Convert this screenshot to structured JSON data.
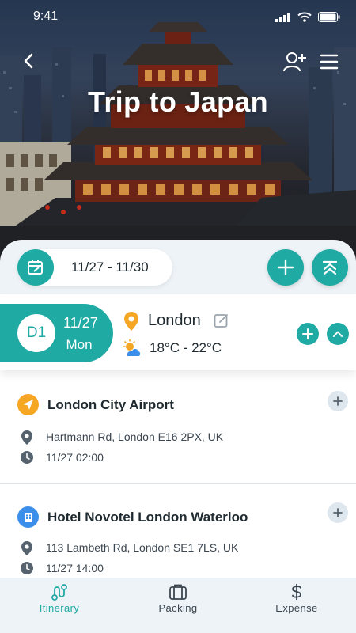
{
  "status_bar": {
    "time": "9:41"
  },
  "header": {
    "title": "Trip to Japan"
  },
  "date_bar": {
    "range": "11/27 - 11/30"
  },
  "day": {
    "code": "D1",
    "date": "11/27",
    "weekday": "Mon",
    "location": "London",
    "temperature": "18°C - 22°C"
  },
  "places": [
    {
      "name": "London City Airport",
      "type_icon": "plane-icon",
      "icon_color": "#f5a623",
      "address": "Hartmann Rd, London E16 2PX, UK",
      "time": "11/27 02:00"
    },
    {
      "name": "Hotel Novotel London Waterloo",
      "type_icon": "hotel-icon",
      "icon_color": "#3b8eea",
      "address": "113 Lambeth Rd, London SE1 7LS, UK",
      "time": "11/27 14:00"
    }
  ],
  "tabs": [
    {
      "label": "Itinerary",
      "icon": "route-icon",
      "active": true
    },
    {
      "label": "Packing",
      "icon": "suitcase-icon",
      "active": false
    },
    {
      "label": "Expense",
      "icon": "dollar-icon",
      "active": false
    }
  ],
  "colors": {
    "accent": "#1faaa4",
    "pin": "#f5a623",
    "text": "#1f2a30",
    "bar_bg": "#eef3f7"
  }
}
